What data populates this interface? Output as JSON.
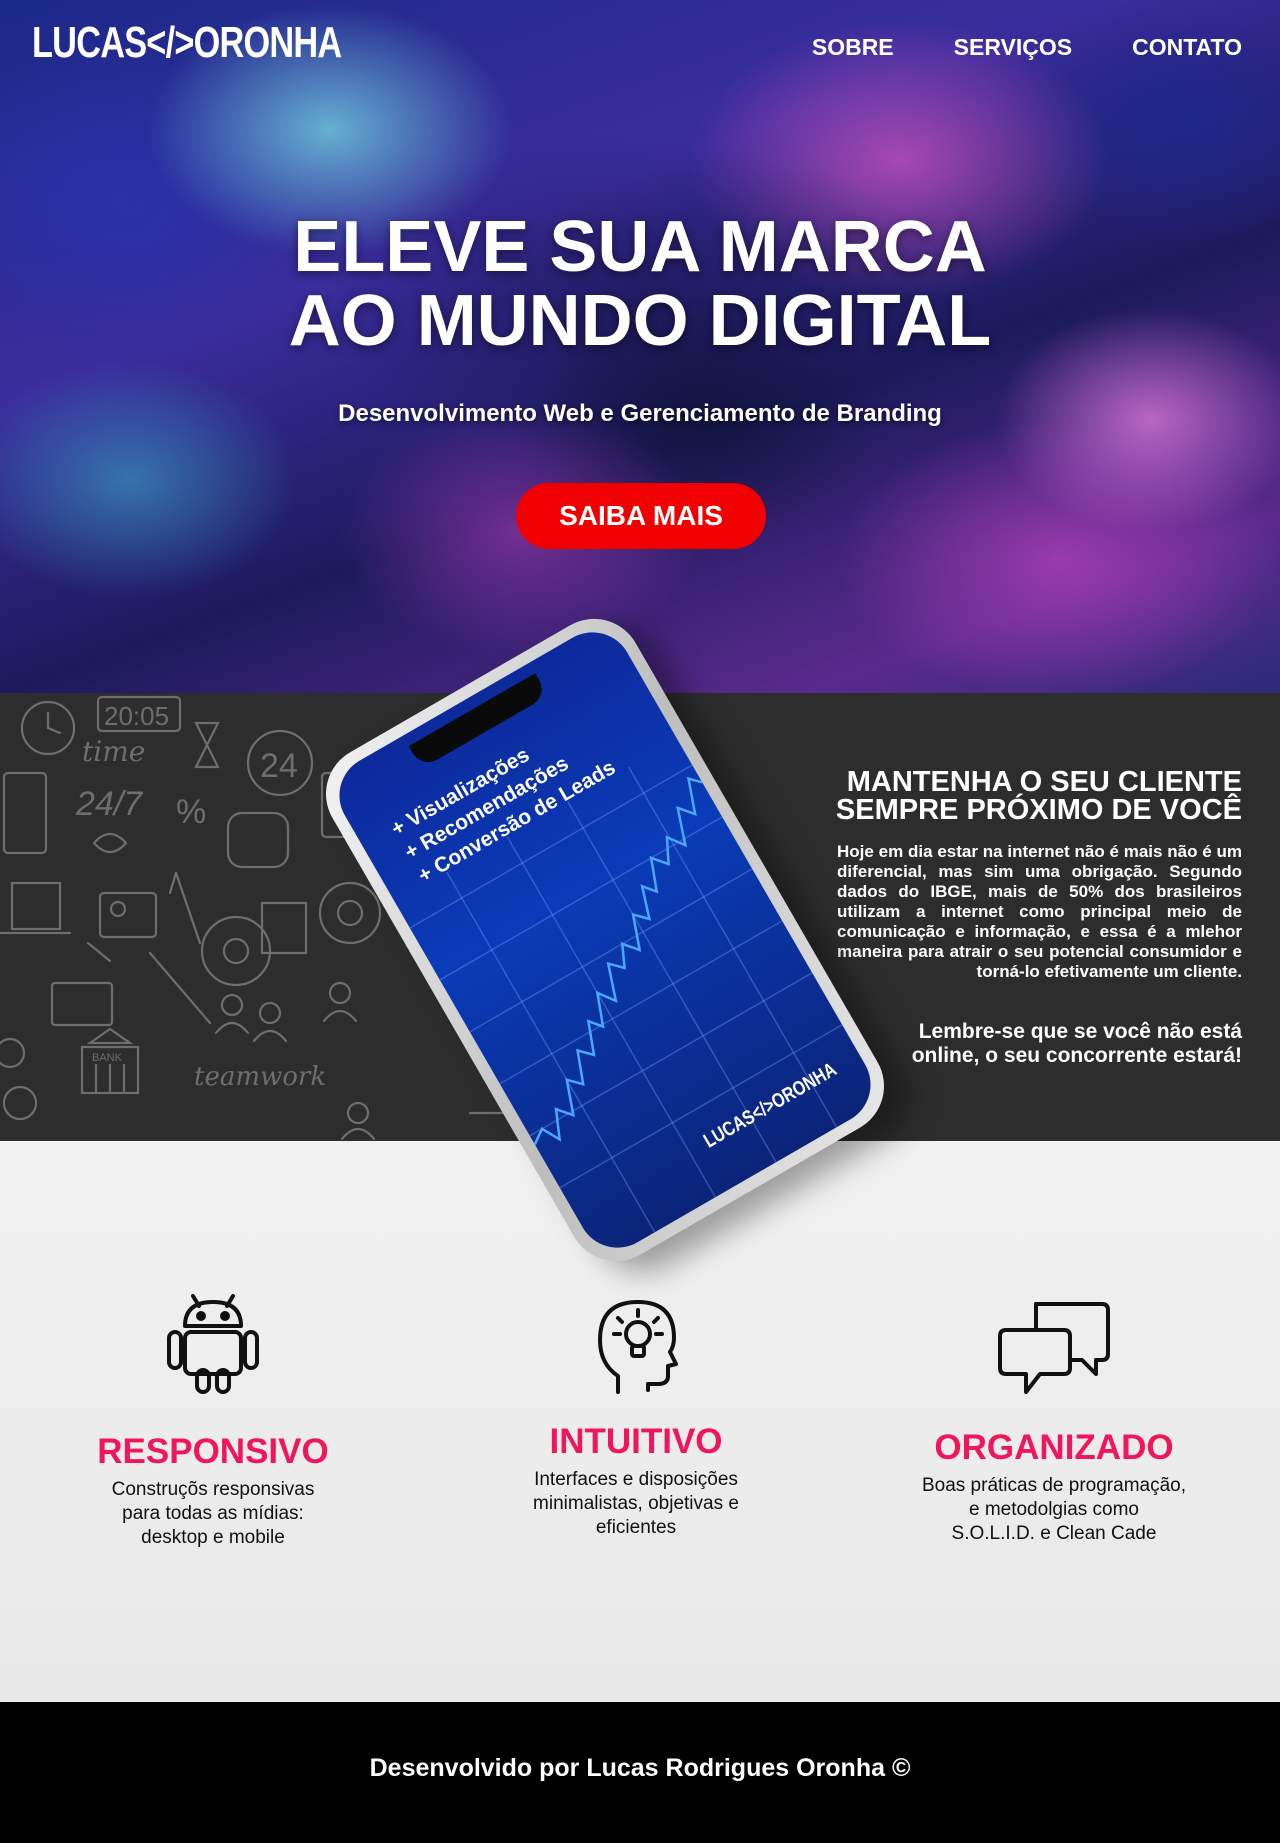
{
  "header": {
    "logo": "LUCAS</>ORONHA",
    "nav": [
      {
        "label": "SOBRE"
      },
      {
        "label": "SERVIÇOS"
      },
      {
        "label": "CONTATO"
      }
    ]
  },
  "hero": {
    "title_line1": "ELEVE SUA MARCA",
    "title_line2": "AO MUNDO DIGITAL",
    "subtitle": "Desenvolvimento Web e Gerenciamento de Branding",
    "cta_label": "SAIBA MAIS",
    "cta_color": "#f00000"
  },
  "phone": {
    "lines": [
      "+ Visualizações",
      "+ Recomendações",
      "+ Conversão de Leads"
    ],
    "logo": "LUCAS</>ORONHA"
  },
  "about": {
    "title_line1": "MANTENHA O SEU CLIENTE",
    "title_line2": "SEMPRE PRÓXIMO DE VOCÊ",
    "text": "Hoje em dia estar na internet não é mais não é um diferencial, mas sim uma obrigação. Segundo dados do IBGE, mais de 50% dos brasileiros utilizam a internet como principal meio de comunicação e informação, e essa é a mlehor maneira para atrair o seu potencial consumidor e torná-lo efetivamente um cliente.",
    "quote_line1": "Lembre-se que se você não está",
    "quote_line2": "online, o seu concorrente estará!"
  },
  "features": [
    {
      "icon": "android-icon",
      "title": "RESPONSIVO",
      "line1": "Construçõs responsivas",
      "line2": "para todas as mídias:",
      "line3": "desktop e mobile"
    },
    {
      "icon": "lightbulb-head-icon",
      "title": "INTUITIVO",
      "line1": "Interfaces e disposições",
      "line2": "minimalistas, objetivas e",
      "line3": "eficientes"
    },
    {
      "icon": "chat-bubbles-icon",
      "title": "ORGANIZADO",
      "line1": "Boas práticas de programação,",
      "line2": "e metodolgias como",
      "line3": "S.O.L.I.D. e Clean Cade"
    }
  ],
  "accent_color": "#f0165a",
  "footer": {
    "text": "Desenvolvido por Lucas Rodrigues Oronha ©"
  }
}
